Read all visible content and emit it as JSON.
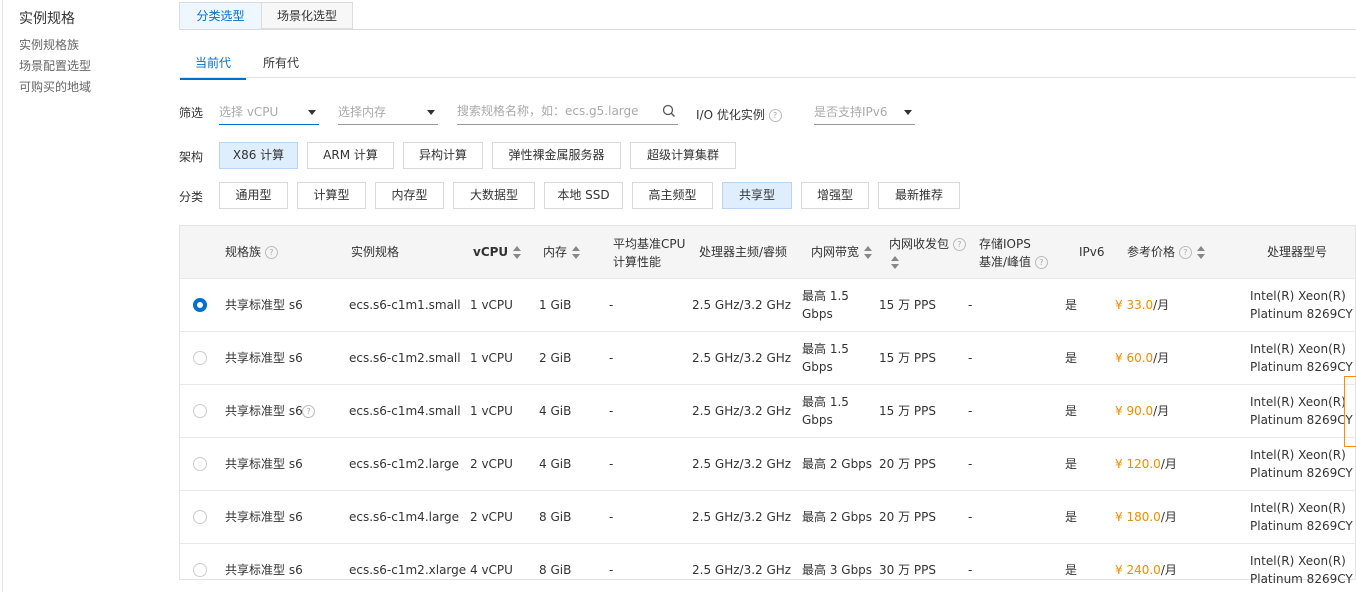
{
  "sidebar": {
    "title": "实例规格",
    "items": [
      "实例规格族",
      "场景配置选型",
      "可购买的地域"
    ]
  },
  "tabs": [
    "分类选型",
    "场景化选型"
  ],
  "generation_tabs": [
    "当前代",
    "所有代"
  ],
  "filter": {
    "label": "筛选",
    "vcpu_placeholder": "选择 vCPU",
    "memory_placeholder": "选择内存",
    "search_placeholder": "搜索规格名称，如：ecs.g5.large",
    "io_label": "I/O 优化实例",
    "ipv6_placeholder": "是否支持IPv6"
  },
  "arch": {
    "label": "架构",
    "options": [
      "X86 计算",
      "ARM 计算",
      "异构计算",
      "弹性裸金属服务器",
      "超级计算集群"
    ],
    "selected": "X86 计算"
  },
  "category": {
    "label": "分类",
    "options": [
      "通用型",
      "计算型",
      "内存型",
      "大数据型",
      "本地 SSD",
      "高主频型",
      "共享型",
      "增强型",
      "最新推荐"
    ],
    "selected": "共享型"
  },
  "table": {
    "headers": {
      "family": "规格族",
      "spec": "实例规格",
      "vcpu": "vCPU",
      "memory": "内存",
      "cpu_perf": [
        "平均基准CPU",
        "计算性能"
      ],
      "freq": "处理器主频/睿频",
      "bandwidth": "内网带宽",
      "pps": "内网收发包",
      "iops": [
        "存储IOPS",
        "基准/峰值"
      ],
      "ipv6": "IPv6",
      "price": "参考价格",
      "cpu_model": "处理器型号"
    },
    "rows": [
      {
        "checked": true,
        "family": "共享标准型 s6",
        "spec": "ecs.s6-c1m1.small",
        "vcpu": "1 vCPU",
        "memory": "1 GiB",
        "cpu_perf": "-",
        "freq": "2.5 GHz/3.2 GHz",
        "bandwidth": [
          "最高 1.5",
          "Gbps"
        ],
        "pps": "15 万 PPS",
        "iops": "-",
        "ipv6": "是",
        "price": "¥ 33.0",
        "unit": "/月",
        "cpu_model": [
          "Intel(R) Xeon(R)",
          "Platinum 8269CY"
        ]
      },
      {
        "checked": false,
        "family": "共享标准型 s6",
        "spec": "ecs.s6-c1m2.small",
        "vcpu": "1 vCPU",
        "memory": "2 GiB",
        "cpu_perf": "-",
        "freq": "2.5 GHz/3.2 GHz",
        "bandwidth": [
          "最高 1.5",
          "Gbps"
        ],
        "pps": "15 万 PPS",
        "iops": "-",
        "ipv6": "是",
        "price": "¥ 60.0",
        "unit": "/月",
        "cpu_model": [
          "Intel(R) Xeon(R)",
          "Platinum 8269CY"
        ]
      },
      {
        "checked": false,
        "family": "共享标准型 s6",
        "spec": "ecs.s6-c1m4.small",
        "vcpu": "1 vCPU",
        "memory": "4 GiB",
        "cpu_perf": "-",
        "freq": "2.5 GHz/3.2 GHz",
        "bandwidth": [
          "最高 1.5",
          "Gbps"
        ],
        "pps": "15 万 PPS",
        "iops": "-",
        "ipv6": "是",
        "price": "¥ 90.0",
        "unit": "/月",
        "cpu_model": [
          "Intel(R) Xeon(R)",
          "Platinum 8269CY"
        ]
      },
      {
        "checked": false,
        "family": "共享标准型 s6",
        "spec": "ecs.s6-c1m2.large",
        "vcpu": "2 vCPU",
        "memory": "4 GiB",
        "cpu_perf": "-",
        "freq": "2.5 GHz/3.2 GHz",
        "bandwidth": [
          "最高 2 Gbps"
        ],
        "pps": "20 万 PPS",
        "iops": "-",
        "ipv6": "是",
        "price": "¥ 120.0",
        "unit": "/月",
        "cpu_model": [
          "Intel(R) Xeon(R)",
          "Platinum 8269CY"
        ]
      },
      {
        "checked": false,
        "family": "共享标准型 s6",
        "spec": "ecs.s6-c1m4.large",
        "vcpu": "2 vCPU",
        "memory": "8 GiB",
        "cpu_perf": "-",
        "freq": "2.5 GHz/3.2 GHz",
        "bandwidth": [
          "最高 2 Gbps"
        ],
        "pps": "20 万 PPS",
        "iops": "-",
        "ipv6": "是",
        "price": "¥ 180.0",
        "unit": "/月",
        "cpu_model": [
          "Intel(R) Xeon(R)",
          "Platinum 8269CY"
        ]
      },
      {
        "checked": false,
        "family": "共享标准型 s6",
        "spec": "ecs.s6-c1m2.xlarge",
        "vcpu": "4 vCPU",
        "memory": "8 GiB",
        "cpu_perf": "-",
        "freq": "2.5 GHz/3.2 GHz",
        "bandwidth": [
          "最高 3 Gbps"
        ],
        "pps": "30 万 PPS",
        "iops": "-",
        "ipv6": "是",
        "price": "¥ 240.0",
        "unit": "/月",
        "cpu_model": [
          "Intel(R) Xeon(R)",
          "Platinum 8269CY"
        ]
      }
    ]
  },
  "colors": {
    "accent": "#0070cc",
    "price": "#f08c00",
    "selected_bg": "#dfeefc"
  }
}
